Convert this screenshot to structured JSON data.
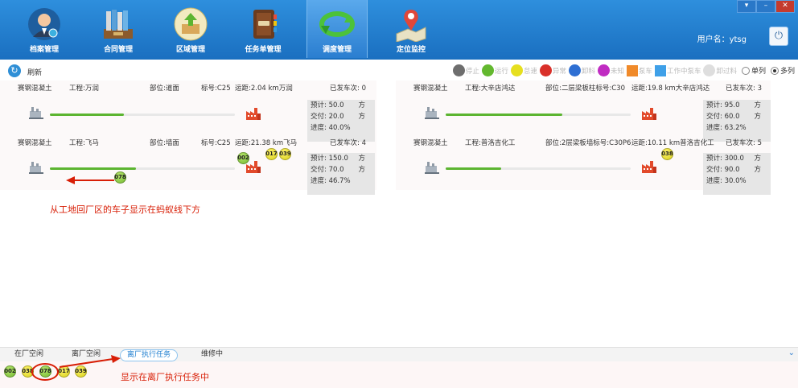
{
  "nav": [
    {
      "label": "档案管理",
      "icon": "user-icon"
    },
    {
      "label": "合同管理",
      "icon": "books-icon"
    },
    {
      "label": "区域管理",
      "icon": "box-upload-icon"
    },
    {
      "label": "任务单管理",
      "icon": "notebook-icon"
    },
    {
      "label": "调度管理",
      "icon": "rotate-icon",
      "active": true
    },
    {
      "label": "定位监控",
      "icon": "map-pin-icon"
    }
  ],
  "window": {
    "min": "▾",
    "restore": "–",
    "close": "✕"
  },
  "user": {
    "label": "用户名：ytsg"
  },
  "toolbar": {
    "refresh": "刷新"
  },
  "legend": [
    {
      "label": "停止",
      "color": "#6e6e6e",
      "shape": "dot"
    },
    {
      "label": "运行",
      "color": "#63b82f",
      "shape": "dot"
    },
    {
      "label": "怠速",
      "color": "#e6df1f",
      "shape": "dot"
    },
    {
      "label": "异常",
      "color": "#d9302a",
      "shape": "dot"
    },
    {
      "label": "卸料",
      "color": "#2e6fd3",
      "shape": "dot"
    },
    {
      "label": "未知",
      "color": "#c02cc2",
      "shape": "dot"
    },
    {
      "label": "泵车",
      "color": "#f08a2a",
      "shape": "sq"
    },
    {
      "label": "工作中泵车",
      "color": "#3fa0e8",
      "shape": "sq"
    },
    {
      "label": "卸过料",
      "color": "#dedede",
      "shape": "dot"
    }
  ],
  "view": {
    "single": "单列",
    "multi": "多列"
  },
  "tasks": [
    {
      "concrete": "赛钢混凝土",
      "project": "工程:万润",
      "part": "部位:道面",
      "grade": "标号:C25",
      "distance": "运距:2.04  km万润",
      "sent": "已发车次: 0",
      "stats": {
        "plan": "预计: 50.0",
        "delivered": "交付: 20.0",
        "progress": "进度: 40.0%",
        "unit": "方"
      },
      "progress": 0.4,
      "cars_top": [],
      "cars_bottom": []
    },
    {
      "concrete": "赛钢混凝土",
      "project": "工程:大辛店鸿达",
      "part": "部位:二层梁板柱标号:C30",
      "grade": "",
      "distance": "运距:19.8  km大辛店鸿达",
      "sent": "已发车次: 3",
      "stats": {
        "plan": "预计: 95.0",
        "delivered": "交付: 60.0",
        "progress": "进度: 63.2%",
        "unit": "方"
      },
      "progress": 0.632,
      "cars_top": [],
      "cars_bottom": []
    },
    {
      "concrete": "赛钢混凝土",
      "project": "工程:飞马",
      "part": "部位:墙面",
      "grade": "标号:C25",
      "distance": "运距:21.38 km飞马",
      "sent": "已发车次: 4",
      "stats": {
        "plan": "预计: 150.0",
        "delivered": "交付: 70.0",
        "progress": "进度: 46.7%",
        "unit": "方"
      },
      "progress": 0.467,
      "cars_top": [
        {
          "id": "002",
          "color": "green"
        },
        {
          "id": "017",
          "color": "yellow"
        },
        {
          "id": "039",
          "color": "yellow"
        }
      ],
      "cars_bottom": [
        {
          "id": "078",
          "color": "green"
        }
      ]
    },
    {
      "concrete": "赛钢混凝土",
      "project": "工程:普洛吉化工",
      "part": "部位:2层梁板墙标号:C30P6",
      "grade": "",
      "distance": "运距:10.11 km普洛吉化工",
      "sent": "已发车次: 5",
      "stats": {
        "plan": "预计: 300.0",
        "delivered": "交付: 90.0",
        "progress": "进度: 30.0%",
        "unit": "方"
      },
      "progress": 0.3,
      "cars_top": [
        {
          "id": "038",
          "color": "yellow"
        }
      ],
      "cars_bottom": []
    }
  ],
  "annotations": {
    "top": "从工地回厂区的车子显示在蚂蚁线下方",
    "bottom": "显示在离厂执行任务中"
  },
  "tabs": [
    "在厂空闲",
    "离厂空闲",
    "离厂执行任务",
    "维修中"
  ],
  "tray": [
    {
      "id": "002",
      "color": "green"
    },
    {
      "id": "038",
      "color": "yellow"
    },
    {
      "id": "078",
      "color": "green"
    },
    {
      "id": "017",
      "color": "yellow"
    },
    {
      "id": "039",
      "color": "yellow"
    }
  ]
}
